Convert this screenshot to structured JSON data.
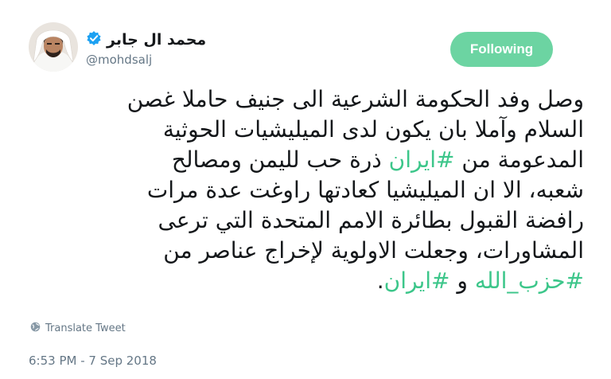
{
  "user": {
    "display_name": "محمد ال جابر",
    "handle": "@mohdsalj"
  },
  "follow_button": {
    "label": "Following"
  },
  "tweet": {
    "lines": [
      [
        {
          "t": "وصل وفد الحكومة الشرعية الى جنيف حاملا غصن"
        }
      ],
      [
        {
          "t": "السلام وآملا بان يكون لدى الميليشيات الحوثية"
        }
      ],
      [
        {
          "t": "المدعومة من "
        },
        {
          "t": "#ايران",
          "tag": true
        },
        {
          "t": " ذرة حب لليمن ومصالح"
        }
      ],
      [
        {
          "t": "شعبه، الا ان الميليشيا كعادتها راوغت عدة مرات"
        }
      ],
      [
        {
          "t": "رافضة القبول بطائرة الامم المتحدة التي ترعى"
        }
      ],
      [
        {
          "t": "المشاورات، وجعلت الاولوية لإخراج  عناصر من"
        }
      ],
      [
        {
          "t": "#حزب_الله",
          "tag": true
        },
        {
          "t": " و "
        },
        {
          "t": "#ايران",
          "tag": true
        },
        {
          "t": "."
        }
      ]
    ]
  },
  "translate": {
    "label": "Translate Tweet"
  },
  "timestamp": "6:53 PM - 7 Sep 2018",
  "colors": {
    "hashtag": "#3cc68a",
    "follow_bg": "#6cd4a2",
    "verified": "#1da1f2",
    "muted": "#657786"
  },
  "icons": {
    "verified": "verified-badge-icon",
    "translate": "globe-icon"
  }
}
